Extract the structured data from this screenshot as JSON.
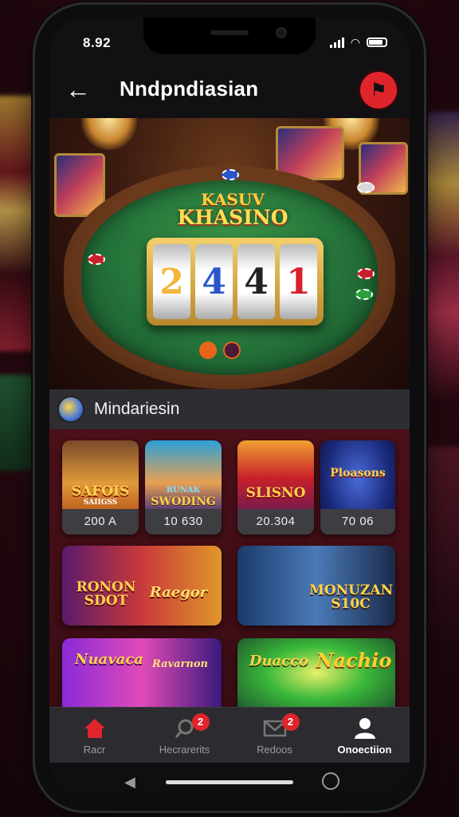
{
  "status_bar": {
    "time": "8.92"
  },
  "header": {
    "title": "Nndpndiasian",
    "back_icon": "arrow-left-icon",
    "logo_icon": "brand-logo-icon"
  },
  "hero": {
    "sign_line1": "KASUV",
    "sign_line2": "KHASINO",
    "reels": [
      "2",
      "4",
      "4",
      "1"
    ]
  },
  "section": {
    "title": "Mindariesin"
  },
  "cards": [
    {
      "title": "SAFOIS",
      "subtitle": "SAIIGSS",
      "value": "200 A"
    },
    {
      "title": "RUNAK",
      "subtitle": "SWODING",
      "value": "10 630"
    },
    {
      "title": "SLISNO",
      "subtitle": "",
      "value": "20.304"
    },
    {
      "title": "Ploasons",
      "subtitle": "",
      "value": "70 06"
    },
    {
      "title": "RONON SDOT",
      "subtitle": "Raegor",
      "value": ""
    },
    {
      "title": "MONUZAN S10C",
      "subtitle": "",
      "value": ""
    },
    {
      "title": "Nuavaca",
      "subtitle": "Ravarnon",
      "value": ""
    },
    {
      "title": "Duacco",
      "subtitle": "Nachio",
      "value": ""
    }
  ],
  "bottom_nav": [
    {
      "label": "Racr",
      "icon": "home-icon",
      "badge": ""
    },
    {
      "label": "Hecrarerits",
      "icon": "search-icon",
      "badge": "2"
    },
    {
      "label": "Redoos",
      "icon": "mail-icon",
      "badge": "2"
    },
    {
      "label": "Onoectiion",
      "icon": "profile-icon",
      "badge": ""
    }
  ],
  "colors": {
    "accent": "#e0242c",
    "felt": "#2f8a42",
    "gold": "#f3d06a",
    "bg": "#3a0c14"
  }
}
